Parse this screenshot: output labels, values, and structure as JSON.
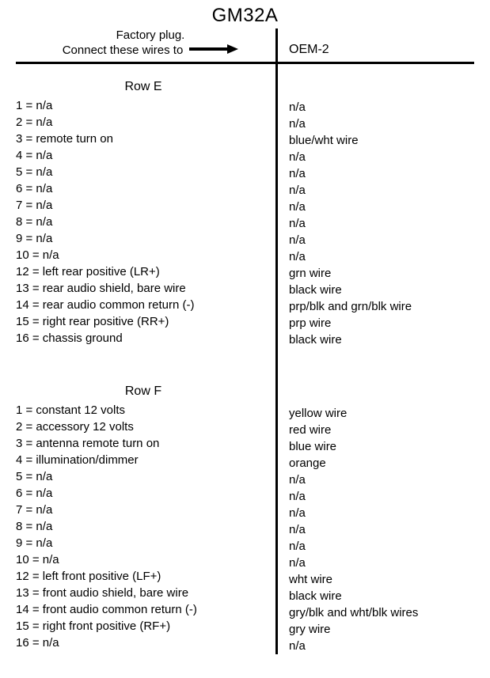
{
  "title": "GM32A",
  "header": {
    "left_line1": "Factory plug.",
    "left_line2": "Connect these wires to",
    "right": "OEM-2"
  },
  "sections": [
    {
      "name": "Row E",
      "rows": [
        {
          "pin": "1",
          "desc": "n/a",
          "oem": "n/a"
        },
        {
          "pin": "2",
          "desc": "n/a",
          "oem": "n/a"
        },
        {
          "pin": "3",
          "desc": "remote turn on",
          "oem": "blue/wht wire"
        },
        {
          "pin": "4",
          "desc": "n/a",
          "oem": "n/a"
        },
        {
          "pin": "5",
          "desc": "n/a",
          "oem": "n/a"
        },
        {
          "pin": "6",
          "desc": "n/a",
          "oem": "n/a"
        },
        {
          "pin": "7",
          "desc": "n/a",
          "oem": "n/a"
        },
        {
          "pin": "8",
          "desc": "n/a",
          "oem": "n/a"
        },
        {
          "pin": "9",
          "desc": "n/a",
          "oem": "n/a"
        },
        {
          "pin": "10",
          "desc": "n/a",
          "oem": "n/a"
        },
        {
          "pin": "12",
          "desc": "left rear positive (LR+)",
          "oem": "grn wire"
        },
        {
          "pin": "13",
          "desc": "rear audio shield, bare wire",
          "oem": "black wire"
        },
        {
          "pin": "14",
          "desc": "rear audio common return (-)",
          "oem": "prp/blk and grn/blk wire"
        },
        {
          "pin": "15",
          "desc": "right rear positive (RR+)",
          "oem": "prp wire"
        },
        {
          "pin": "16",
          "desc": "chassis ground",
          "oem": "black wire"
        }
      ]
    },
    {
      "name": "Row F",
      "rows": [
        {
          "pin": "1",
          "desc": "constant 12 volts",
          "oem": "yellow wire"
        },
        {
          "pin": "2",
          "desc": "accessory 12 volts",
          "oem": "red wire"
        },
        {
          "pin": "3",
          "desc": "antenna remote turn on",
          "oem": "blue wire"
        },
        {
          "pin": "4",
          "desc": "illumination/dimmer",
          "oem": "orange"
        },
        {
          "pin": "5",
          "desc": "n/a",
          "oem": "n/a"
        },
        {
          "pin": "6",
          "desc": "n/a",
          "oem": "n/a"
        },
        {
          "pin": "7",
          "desc": "n/a",
          "oem": "n/a"
        },
        {
          "pin": "8",
          "desc": "n/a",
          "oem": "n/a"
        },
        {
          "pin": "9",
          "desc": "n/a",
          "oem": "n/a"
        },
        {
          "pin": "10",
          "desc": "n/a",
          "oem": "n/a"
        },
        {
          "pin": "12",
          "desc": "left front positive (LF+)",
          "oem": "wht wire"
        },
        {
          "pin": "13",
          "desc": "front audio shield, bare wire",
          "oem": "black wire"
        },
        {
          "pin": "14",
          "desc": "front audio common return (-)",
          "oem": "gry/blk and wht/blk wires"
        },
        {
          "pin": "15",
          "desc": "right front positive (RF+)",
          "oem": "gry wire"
        },
        {
          "pin": "16",
          "desc": "n/a",
          "oem": "n/a"
        }
      ]
    }
  ]
}
